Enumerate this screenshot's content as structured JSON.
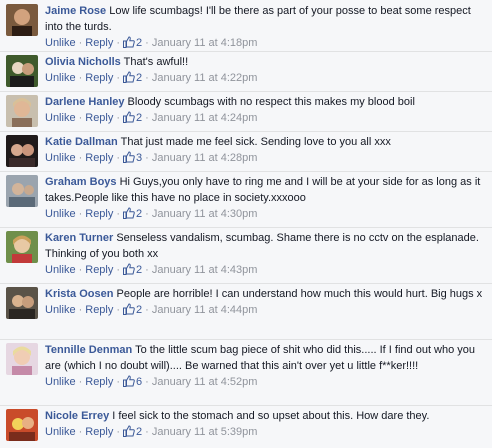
{
  "comments": [
    {
      "author": "Jaime Rose",
      "text": "Low life scumbags! I'll be there as part of your posse to beat some respect into the turds.",
      "unlike": "Unlike",
      "reply": "Reply",
      "likes": "2",
      "time": "January 11 at 4:18pm",
      "avatar_bg": "#7a5a3e",
      "avatar_fg": "#2d1d14"
    },
    {
      "author": "Olivia Nicholls",
      "text": "That's awful!!",
      "unlike": "Unlike",
      "reply": "Reply",
      "likes": "2",
      "time": "January 11 at 4:22pm",
      "avatar_bg": "#3f5a2c",
      "avatar_fg": "#e7d7c2"
    },
    {
      "author": "Darlene Hanley",
      "text": "Bloody scumbags with no respect this makes my blood boil",
      "unlike": "Unlike",
      "reply": "Reply",
      "likes": "2",
      "time": "January 11 at 4:24pm",
      "avatar_bg": "#c8bfae",
      "avatar_fg": "#d9c097"
    },
    {
      "author": "Katie Dallman",
      "text": "That just made me feel sick. Sending love to you all xxx",
      "unlike": "Unlike",
      "reply": "Reply",
      "likes": "3",
      "time": "January 11 at 4:28pm",
      "avatar_bg": "#1f1a1a",
      "avatar_fg": "#d5a88e"
    },
    {
      "author": "Graham Boys",
      "text": "Hi Guys,you only have to ring me and I will be at your side for as long as it takes.People like this have no place in society.xxxooo",
      "unlike": "Unlike",
      "reply": "Reply",
      "likes": "2",
      "time": "January 11 at 4:30pm",
      "avatar_bg": "#9aa4ae",
      "avatar_fg": "#5b6a78"
    },
    {
      "author": "Karen Turner",
      "text": "Senseless vandalism, scumbag. Shame there is no cctv on the esplanade. Thinking of you both xx",
      "unlike": "Unlike",
      "reply": "Reply",
      "likes": "2",
      "time": "January 11 at 4:43pm",
      "avatar_bg": "#6f8f4a",
      "avatar_fg": "#e8c9a4"
    },
    {
      "author": "Krista Oosen",
      "text": "People are horrible! I can understand how much this would hurt. Big hugs x",
      "unlike": "Unlike",
      "reply": "Reply",
      "likes": "2",
      "time": "January 11 at 4:44pm",
      "avatar_bg": "#5a5348",
      "avatar_fg": "#d9b38f"
    },
    {
      "author": "Tennille Denman",
      "text": "To the little scum bag piece of shit who did this..... If I find out who you are (which I no doubt will).... Be warned that this ain't over yet u little f**ker!!!!",
      "unlike": "Unlike",
      "reply": "Reply",
      "likes": "6",
      "time": "January 11 at 4:52pm",
      "avatar_bg": "#e6d7e2",
      "avatar_fg": "#c58aa8"
    },
    {
      "author": "Nicole Errey",
      "text": "I feel sick to the stomach and so upset about this. How dare they.",
      "unlike": "Unlike",
      "reply": "Reply",
      "likes": "2",
      "time": "January 11 at 5:39pm",
      "avatar_bg": "#c94b2a",
      "avatar_fg": "#f2d25a"
    }
  ]
}
